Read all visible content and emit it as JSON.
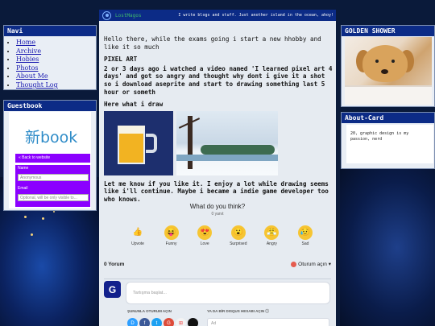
{
  "header": {
    "site_name": "LostMagos",
    "tagline": "I write blogs and stuff. Just another island in the ocean, ahoy!"
  },
  "navi": {
    "title": "Navi",
    "items": [
      {
        "label": "Home"
      },
      {
        "label": "Archive"
      },
      {
        "label": "Hobies"
      },
      {
        "label": "Photos"
      },
      {
        "label": "About Me"
      },
      {
        "label": "Thought Log"
      }
    ]
  },
  "guestbook": {
    "title": "Guestbook",
    "logo_text": "新book",
    "back_label": "« Back to website",
    "name_label": "Name",
    "name_placeholder": "Anonymous",
    "email_label": "Email",
    "email_placeholder": "Optional, will be only visible to..."
  },
  "post": {
    "intro": "Hello there, while the exams going i start a new hhobby and like it so much",
    "heading": "PIXEL ART",
    "body": "2 or 3 days ago i watched a video named 'I learned pixel art 4 days' and got so angry and thought why dont i give it a shot so i download aseprite and start to drawing something last 5 hour or someth",
    "draw_label": "Here what i draw",
    "outro": "Let me know if you like it. I enjoy a lot while drawing seems like i'll continue. Maybe i became a indie game developer too who knows."
  },
  "reactions": {
    "title": "What do you think?",
    "count": "0 yanıt",
    "items": [
      {
        "label": "Upvote",
        "icon": "thumbs-up-icon",
        "glyph": "👍"
      },
      {
        "label": "Funny",
        "icon": "laughing-face-icon",
        "glyph": "😝"
      },
      {
        "label": "Love",
        "icon": "heart-eyes-icon",
        "glyph": "😍"
      },
      {
        "label": "Surprised",
        "icon": "surprised-face-icon",
        "glyph": "😮"
      },
      {
        "label": "Angry",
        "icon": "angry-face-icon",
        "glyph": "😤"
      },
      {
        "label": "Sad",
        "icon": "sad-face-icon",
        "glyph": "😥"
      }
    ]
  },
  "comments": {
    "count_label": "0 Yorum",
    "login_label": "Oturum açın ▾",
    "avatar_letter": "G",
    "placeholder": "Tartışma başlat...",
    "login_with_label": "ŞUNUNLA OTURUM AÇIN",
    "disqus_label": "YA DA BİR DISQUS HESABI AÇIN ⓘ",
    "name_placeholder": "Ad",
    "socials": [
      {
        "letter": "D",
        "color": "#2e9fff"
      },
      {
        "letter": "f",
        "color": "#3b5998"
      },
      {
        "letter": "t",
        "color": "#1da1f2"
      },
      {
        "letter": "G",
        "color": "#dd4b39"
      },
      {
        "letter": "⊞",
        "color": "#f3f3f3"
      },
      {
        "letter": "",
        "color": "#111111"
      }
    ]
  },
  "golden_shower": {
    "title": "GOLDEN SHOWER"
  },
  "about_card": {
    "title": "About-Card",
    "text": "20, graphic design is my passion, nerd"
  }
}
